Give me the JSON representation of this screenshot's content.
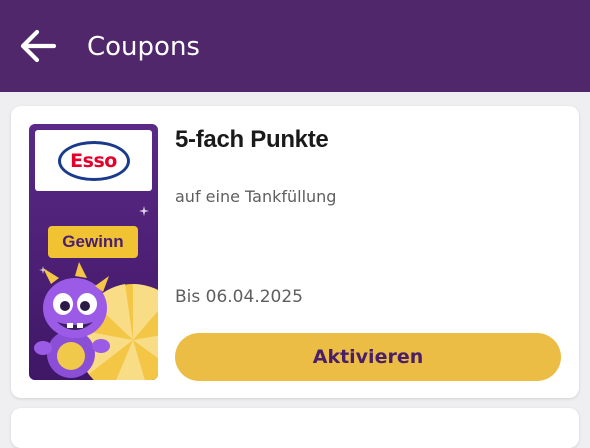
{
  "header": {
    "title": "Coupons",
    "back_icon": "arrow-left-icon",
    "background_color": "#51276b"
  },
  "coupon": {
    "brand_logo_text": "Esso",
    "promo_badge": "Gewinn",
    "title": "5-fach Punkte",
    "subtitle": "auf eine Tankfüllung",
    "validity": "Bis 06.04.2025",
    "action_label": "Aktivieren",
    "action_color": "#ebbd44"
  }
}
